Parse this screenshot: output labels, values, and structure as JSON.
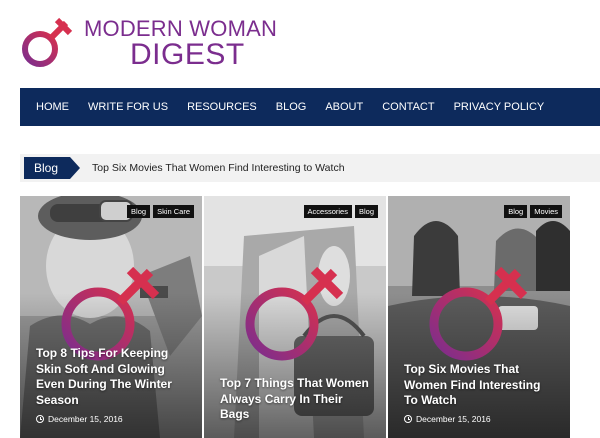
{
  "brand": {
    "line1": "MODERN WOMAN",
    "line2": "DIGEST",
    "symbol_icon": "female-symbol-icon",
    "colors": {
      "purple": "#7b2d8e",
      "magenta": "#d6304f"
    }
  },
  "nav": {
    "items": [
      {
        "label": "HOME",
        "active": true
      },
      {
        "label": "WRITE FOR US"
      },
      {
        "label": "RESOURCES"
      },
      {
        "label": "BLOG"
      },
      {
        "label": "ABOUT"
      },
      {
        "label": "CONTACT"
      },
      {
        "label": "PRIVACY POLICY"
      }
    ],
    "background": "#0d2a5c"
  },
  "ticker": {
    "label": "Blog",
    "headline": "Top Six Movies That Women Find Interesting to Watch"
  },
  "cards": [
    {
      "tags": [
        "Blog",
        "Skin Care"
      ],
      "title": "Top 8 Tips For Keeping Skin Soft And Glowing Even During The Winter Season",
      "date": "December 15, 2016"
    },
    {
      "tags": [
        "Accessories",
        "Blog"
      ],
      "title": "Top 7 Things That Women Always Carry In Their Bags",
      "date": "December 15, 2016"
    },
    {
      "tags": [
        "Blog",
        "Movies"
      ],
      "title": "Top Six Movies That Women Find Interesting To Watch",
      "date": "December 15, 2016"
    }
  ]
}
